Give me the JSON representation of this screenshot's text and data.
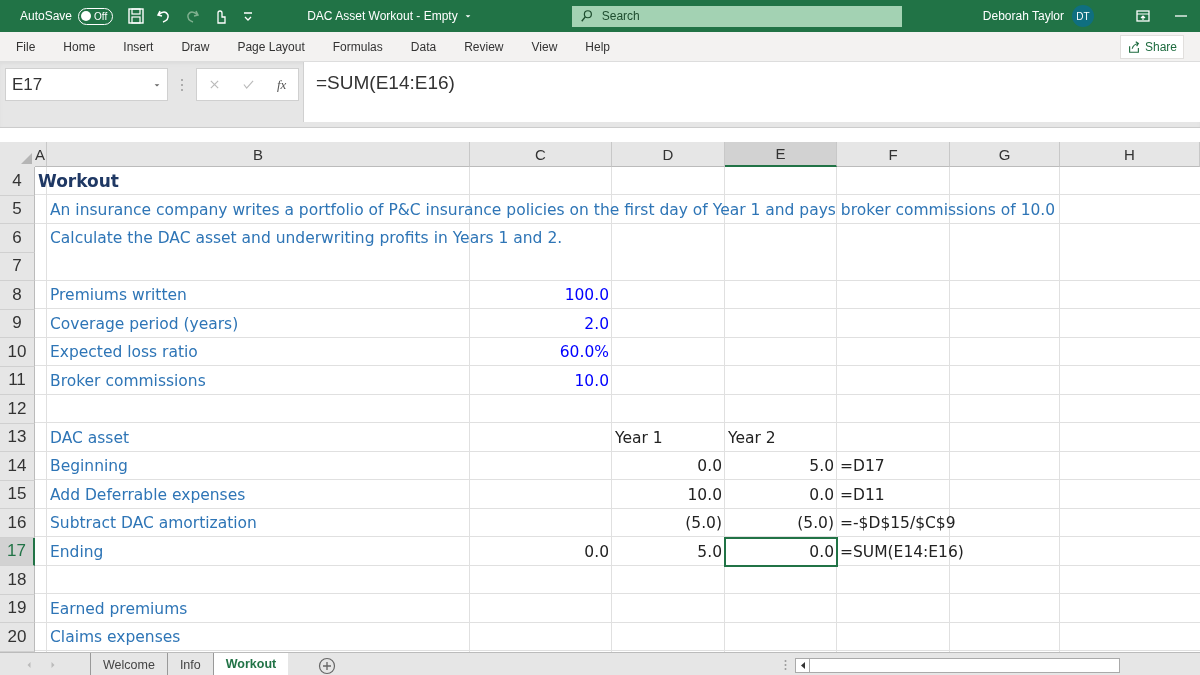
{
  "title_bar": {
    "autosave_label": "AutoSave",
    "autosave": {
      "on": false,
      "label": "Off"
    },
    "title": "DAC Asset Workout - Empty",
    "search": {
      "placeholder": "Search"
    },
    "user": "Deborah Taylor",
    "avatar": "DT"
  },
  "ribbon_tabs": [
    "File",
    "Home",
    "Insert",
    "Draw",
    "Page Layout",
    "Formulas",
    "Data",
    "Review",
    "View",
    "Help"
  ],
  "share_button": "Share",
  "formula_bar": {
    "name_box": "E17",
    "fx": "fx",
    "formula": "=SUM(E14:E16)"
  },
  "columns": [
    {
      "label": "A",
      "selected": false
    },
    {
      "label": "B",
      "selected": false
    },
    {
      "label": "C",
      "selected": false
    },
    {
      "label": "D",
      "selected": false
    },
    {
      "label": "E",
      "selected": true
    },
    {
      "label": "F",
      "selected": false
    },
    {
      "label": "G",
      "selected": false
    },
    {
      "label": "H",
      "selected": false
    }
  ],
  "rows": [
    {
      "number": "4",
      "selected": false,
      "cells": {
        "A": {
          "kind": "heading",
          "text": "Workout",
          "selected": false
        }
      }
    },
    {
      "number": "5",
      "selected": false,
      "cells": {
        "B": {
          "kind": "label",
          "text": "An insurance company writes a portfolio of P&C insurance policies on the first day of Year 1 and pays broker commissions of 10.0",
          "selected": false
        }
      }
    },
    {
      "number": "6",
      "selected": false,
      "cells": {
        "B": {
          "kind": "label",
          "text": "Calculate the DAC asset and underwriting profits in Years 1 and 2.",
          "selected": false
        }
      }
    },
    {
      "number": "7",
      "selected": false
    },
    {
      "number": "8",
      "selected": false,
      "cells": {
        "B": {
          "kind": "label",
          "text": "Premiums written",
          "selected": false
        },
        "C": {
          "kind": "input",
          "text": "100.0",
          "selected": false
        }
      }
    },
    {
      "number": "9",
      "selected": false,
      "cells": {
        "B": {
          "kind": "label",
          "text": "Coverage period (years)",
          "selected": false
        },
        "C": {
          "kind": "input",
          "text": "2.0",
          "selected": false
        }
      }
    },
    {
      "number": "10",
      "selected": false,
      "cells": {
        "B": {
          "kind": "label",
          "text": "Expected loss ratio",
          "selected": false
        },
        "C": {
          "kind": "input",
          "text": "60.0%",
          "selected": false
        }
      }
    },
    {
      "number": "11",
      "selected": false,
      "cells": {
        "B": {
          "kind": "label",
          "text": "Broker commissions",
          "selected": false
        },
        "C": {
          "kind": "input",
          "text": "10.0",
          "selected": false
        }
      }
    },
    {
      "number": "12",
      "selected": false
    },
    {
      "number": "13",
      "selected": false,
      "cells": {
        "B": {
          "kind": "label",
          "text": "DAC asset",
          "selected": false
        },
        "D": {
          "kind": "text",
          "text": "Year 1",
          "selected": false
        },
        "E": {
          "kind": "text",
          "text": "Year 2",
          "selected": false
        }
      }
    },
    {
      "number": "14",
      "selected": false,
      "cells": {
        "B": {
          "kind": "label",
          "text": "Beginning",
          "selected": false
        },
        "D": {
          "kind": "number",
          "text": "0.0",
          "selected": false
        },
        "E": {
          "kind": "number",
          "text": "5.0",
          "selected": false
        },
        "F": {
          "kind": "text",
          "text": "=D17",
          "selected": false
        }
      }
    },
    {
      "number": "15",
      "selected": false,
      "cells": {
        "B": {
          "kind": "label",
          "text": "Add Deferrable expenses",
          "selected": false
        },
        "D": {
          "kind": "number",
          "text": "10.0",
          "selected": false
        },
        "E": {
          "kind": "number",
          "text": "0.0",
          "selected": false
        },
        "F": {
          "kind": "text",
          "text": "=D11",
          "selected": false
        }
      }
    },
    {
      "number": "16",
      "selected": false,
      "cells": {
        "B": {
          "kind": "label",
          "text": "Subtract DAC amortization",
          "selected": false
        },
        "D": {
          "kind": "number",
          "text": "(5.0)",
          "selected": false
        },
        "E": {
          "kind": "number",
          "text": "(5.0)",
          "selected": false
        },
        "F": {
          "kind": "text",
          "text": "=-$D$15/$C$9",
          "selected": false
        }
      }
    },
    {
      "number": "17",
      "selected": true,
      "cells": {
        "B": {
          "kind": "label",
          "text": "Ending",
          "selected": false
        },
        "C": {
          "kind": "number",
          "text": "0.0",
          "selected": false
        },
        "D": {
          "kind": "number",
          "text": "5.0",
          "selected": false
        },
        "E": {
          "kind": "number",
          "text": "0.0",
          "selected": true
        },
        "F": {
          "kind": "text",
          "text": "=SUM(E14:E16)",
          "selected": false
        }
      }
    },
    {
      "number": "18",
      "selected": false
    },
    {
      "number": "19",
      "selected": false,
      "cells": {
        "B": {
          "kind": "label",
          "text": "Earned premiums",
          "selected": false
        }
      }
    },
    {
      "number": "20",
      "selected": false,
      "cells": {
        "B": {
          "kind": "label",
          "text": "Claims expenses",
          "selected": false
        }
      }
    }
  ],
  "sheet_tabs": [
    {
      "label": "Welcome",
      "selected": false
    },
    {
      "label": "Info",
      "selected": false
    },
    {
      "label": "Workout",
      "selected": true
    }
  ]
}
